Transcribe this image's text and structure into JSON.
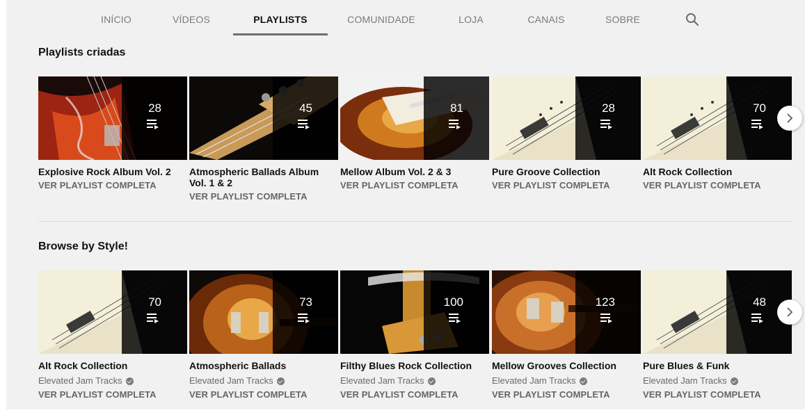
{
  "tabs": [
    "INÍCIO",
    "VÍDEOS",
    "PLAYLISTS",
    "COMUNIDADE",
    "LOJA",
    "CANAIS",
    "SOBRE"
  ],
  "active_tab": "PLAYLISTS",
  "sections": [
    {
      "title": "Playlists criadas",
      "cards": [
        {
          "title": "Explosive Rock Album Vol. 2",
          "count": "28",
          "link": "VER PLAYLIST COMPLETA"
        },
        {
          "title": "Atmospheric Ballads Album Vol. 1 & 2",
          "count": "45",
          "link": "VER PLAYLIST COMPLETA"
        },
        {
          "title": "Mellow Album Vol. 2 & 3",
          "count": "81",
          "link": "VER PLAYLIST COMPLETA"
        },
        {
          "title": "Pure Groove Collection",
          "count": "28",
          "link": "VER PLAYLIST COMPLETA"
        },
        {
          "title": "Alt Rock Collection",
          "count": "70",
          "link": "VER PLAYLIST COMPLETA"
        }
      ]
    },
    {
      "title": "Browse by Style!",
      "cards": [
        {
          "title": "Alt Rock Collection",
          "channel": "Elevated Jam Tracks",
          "count": "70",
          "link": "VER PLAYLIST COMPLETA"
        },
        {
          "title": "Atmospheric Ballads",
          "channel": "Elevated Jam Tracks",
          "count": "73",
          "link": "VER PLAYLIST COMPLETA"
        },
        {
          "title": "Filthy Blues Rock Collection",
          "channel": "Elevated Jam Tracks",
          "count": "100",
          "link": "VER PLAYLIST COMPLETA"
        },
        {
          "title": "Mellow Grooves Collection",
          "channel": "Elevated Jam Tracks",
          "count": "123",
          "link": "VER PLAYLIST COMPLETA"
        },
        {
          "title": "Pure Blues & Funk",
          "channel": "Elevated Jam Tracks",
          "count": "48",
          "link": "VER PLAYLIST COMPLETA"
        }
      ]
    }
  ],
  "icons": {
    "search": "search-icon",
    "playlist": "playlist-icon",
    "verified": "verified-icon",
    "next": "chevron-right-icon"
  },
  "colors": {
    "background": "#f1f1f1",
    "overlay": "#000000",
    "text_primary": "#111111",
    "text_secondary": "#666666"
  }
}
